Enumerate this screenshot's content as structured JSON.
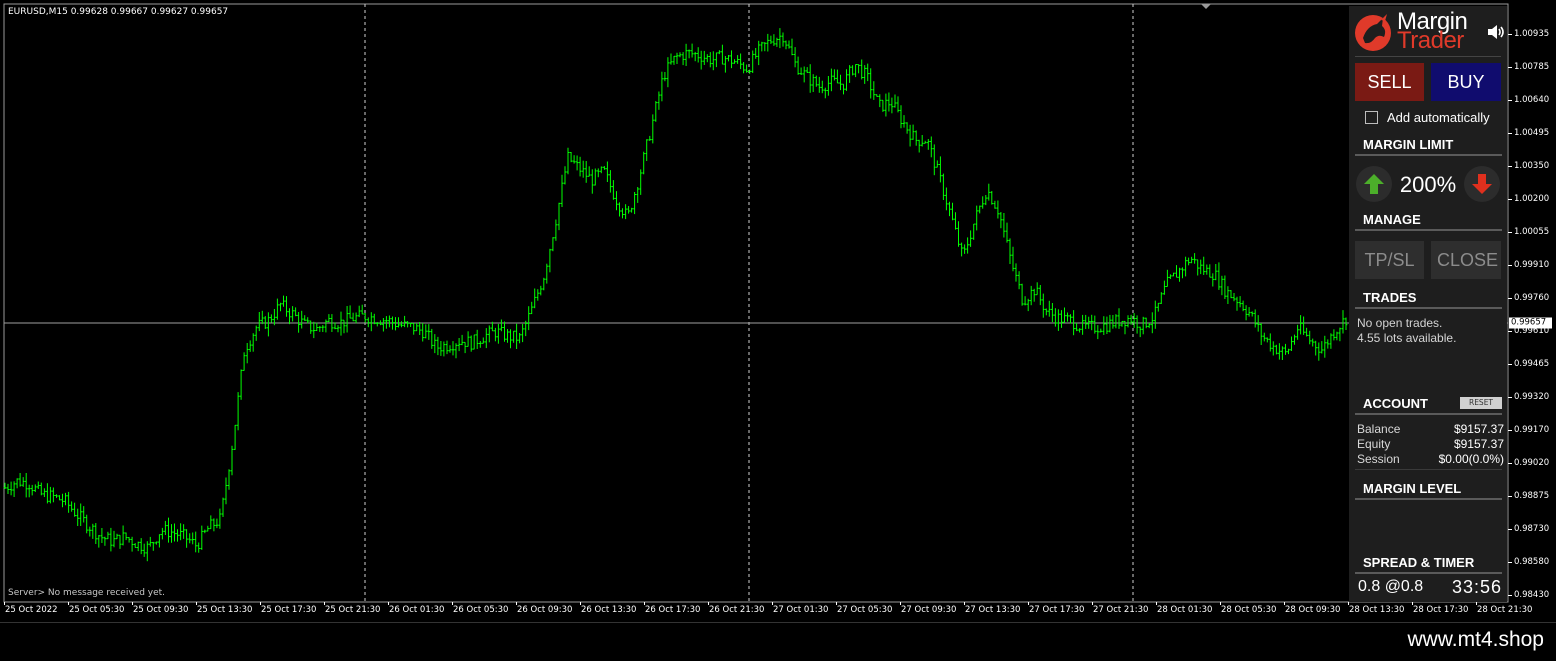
{
  "symbol_info": "EURUSD,M15  0.99628 0.99667 0.99627 0.99657",
  "server_message": "Server>  No message received yet.",
  "watermark": "www.mt4.shop",
  "colors": {
    "candle": "#00ff00",
    "background": "#000000",
    "sell": "#7a1a14",
    "buy": "#100c6e",
    "panel": "#1e1e1e",
    "arrow_up": "#4caf2a",
    "arrow_down": "#e0301e"
  },
  "price_axis": {
    "labels": [
      "1.00935",
      "1.00785",
      "1.00640",
      "1.00495",
      "1.00350",
      "1.00200",
      "1.00055",
      "0.99910",
      "0.99760",
      "0.99610",
      "0.99465",
      "0.99320",
      "0.99170",
      "0.99020",
      "0.98875",
      "0.98730",
      "0.98580",
      "0.98430"
    ],
    "current": "0.99657"
  },
  "time_axis": {
    "labels": [
      "25 Oct 2022",
      "25 Oct 05:30",
      "25 Oct 09:30",
      "25 Oct 13:30",
      "25 Oct 17:30",
      "25 Oct 21:30",
      "26 Oct 01:30",
      "26 Oct 05:30",
      "26 Oct 09:30",
      "26 Oct 13:30",
      "26 Oct 17:30",
      "26 Oct 21:30",
      "27 Oct 01:30",
      "27 Oct 05:30",
      "27 Oct 09:30",
      "27 Oct 13:30",
      "27 Oct 17:30",
      "27 Oct 21:30",
      "28 Oct 01:30",
      "28 Oct 05:30",
      "28 Oct 09:30",
      "28 Oct 13:30",
      "28 Oct 17:30",
      "28 Oct 21:30"
    ]
  },
  "chart_data": {
    "type": "line",
    "title": "EURUSD,M15",
    "series": [
      {
        "name": "EURUSD",
        "values": [
          0.989,
          0.9893,
          0.9892,
          0.9887,
          0.9886,
          0.9884,
          0.9878,
          0.9873,
          0.9868,
          0.9866,
          0.9868,
          0.9865,
          0.9863,
          0.9871,
          0.987,
          0.9868,
          0.9864,
          0.9872,
          0.9876,
          0.991,
          0.9952,
          0.9962,
          0.9965,
          0.9972,
          0.9968,
          0.9963,
          0.9961,
          0.9965,
          0.9964,
          0.9966,
          0.9967,
          0.9966,
          0.9965,
          0.9963,
          0.9962,
          0.996,
          0.9953,
          0.9954,
          0.9956,
          0.9955,
          0.9958,
          0.996,
          0.9958,
          0.9957,
          0.997,
          0.9985,
          1.001,
          1.0038,
          1.0033,
          1.0028,
          1.0032,
          1.002,
          1.0011,
          1.003,
          1.0052,
          1.0075,
          1.0083,
          1.0085,
          1.0084,
          1.0082,
          1.0083,
          1.0081,
          1.0078,
          1.0086,
          1.0091,
          1.0093,
          1.008,
          1.0074,
          1.007,
          1.0072,
          1.0071,
          1.008,
          1.0074,
          1.0061,
          1.0063,
          1.0054,
          1.0046,
          1.0046,
          1.003,
          1.0012,
          0.9993,
          1.001,
          1.0024,
          1.0014,
          0.9992,
          0.9974,
          0.9979,
          0.9969,
          0.9966,
          0.9965,
          0.9962,
          0.9962,
          0.9963,
          0.9965,
          0.9966,
          0.9963,
          0.9967,
          0.9981,
          0.9987,
          0.9993,
          0.9988,
          0.9986,
          0.9978,
          0.9974,
          0.9968,
          0.9958,
          0.9953,
          0.995,
          0.9962,
          0.9956,
          0.9952,
          0.996,
          0.9966
        ]
      }
    ],
    "ylim": [
      0.9843,
      1.00985
    ],
    "grid": false,
    "xlabel": "",
    "ylabel": ""
  },
  "panel": {
    "logo_line1": "Margin",
    "logo_line2": "Trader",
    "sell_label": "SELL",
    "buy_label": "BUY",
    "auto_add_label": "Add automatically",
    "margin_limit_header": "MARGIN LIMIT",
    "margin_limit_value": "200%",
    "manage_header": "MANAGE",
    "tpsl_label": "TP/SL",
    "close_label": "CLOSE",
    "trades_header": "TRADES",
    "trades_line1": "No open trades.",
    "trades_line2": "4.55 lots available.",
    "account_header": "ACCOUNT",
    "reset_label": "RESET",
    "balance_label": "Balance",
    "balance_value": "$9157.37",
    "equity_label": "Equity",
    "equity_value": "$9157.37",
    "session_label": "Session",
    "session_value": "$0.00(0.0%)",
    "margin_level_header": "MARGIN LEVEL",
    "spread_timer_header": "SPREAD & TIMER",
    "spread_value": "0.8 @0.8",
    "timer_value": "33:56"
  }
}
